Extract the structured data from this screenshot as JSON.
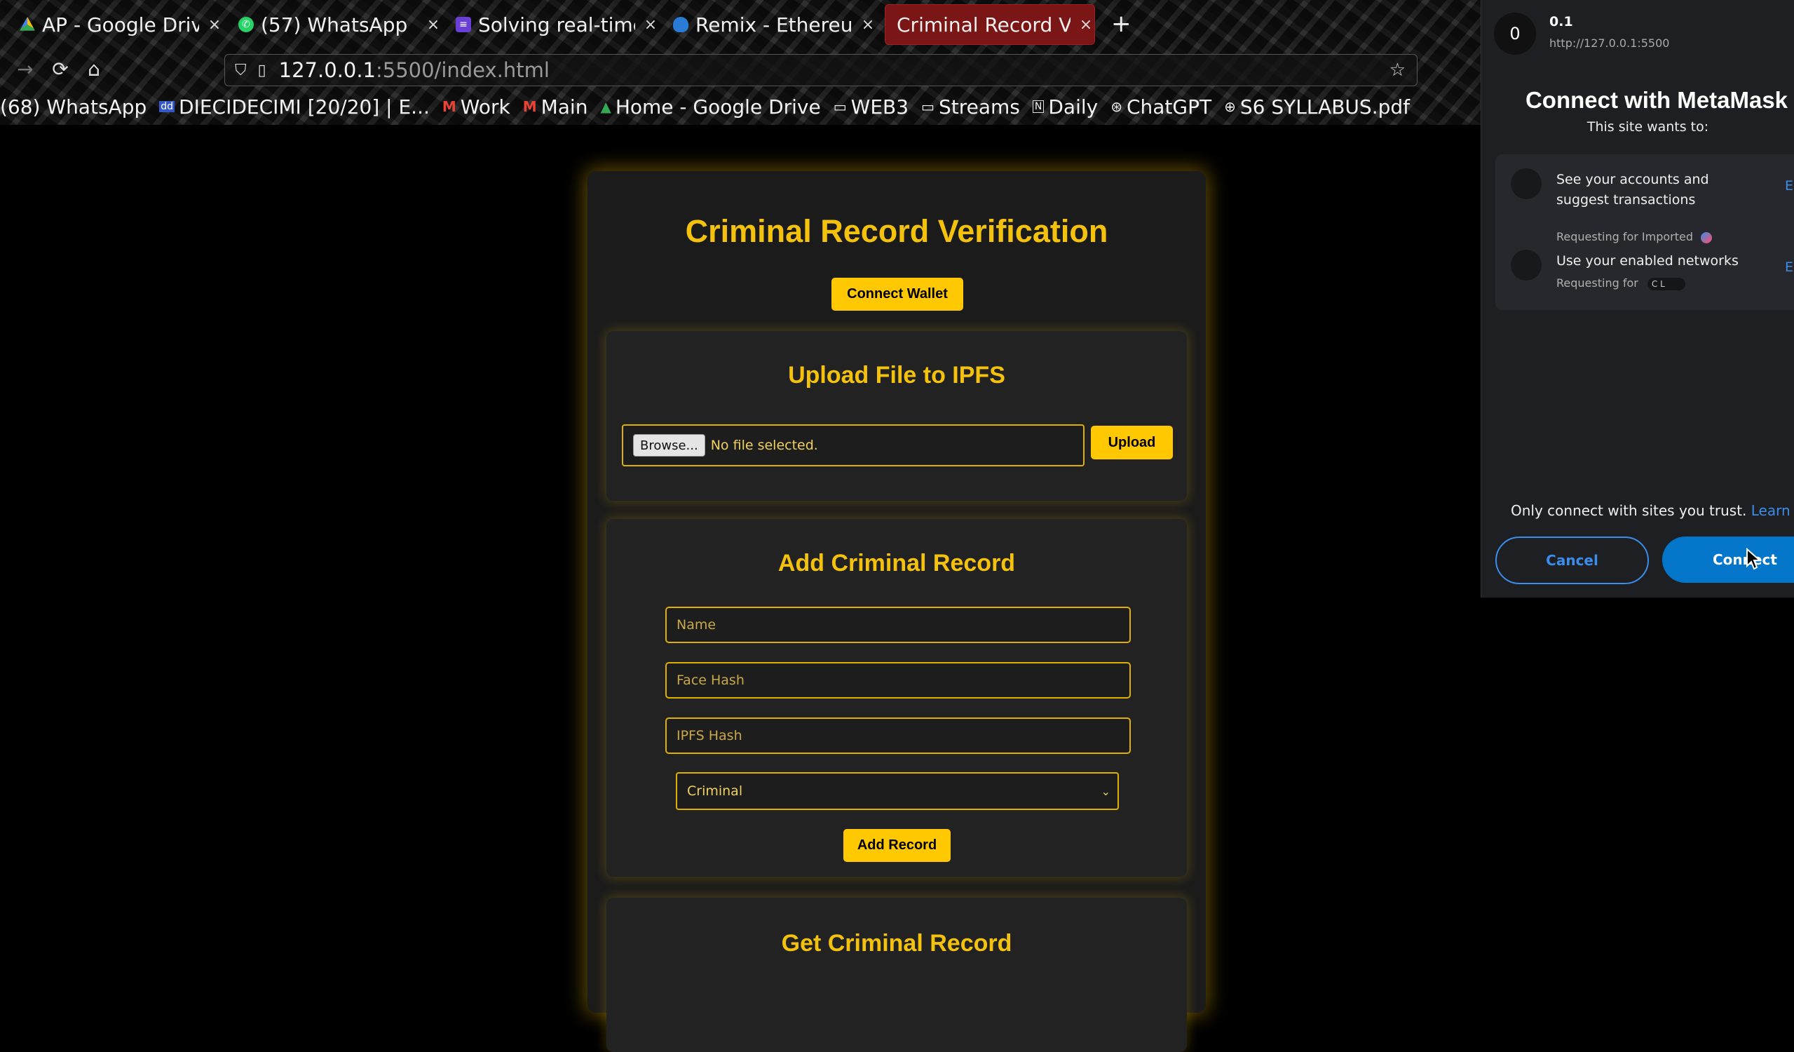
{
  "browser": {
    "tabs": [
      {
        "title": "AP - Google Drive",
        "icon": "google-drive-icon",
        "close": "×"
      },
      {
        "title": "(57) WhatsApp",
        "icon": "whatsapp-icon",
        "close": "×"
      },
      {
        "title": "Solving real-time u",
        "icon": "document-icon",
        "close": "×"
      },
      {
        "title": "Remix - Ethereum",
        "icon": "remix-icon",
        "close": "×"
      },
      {
        "title": "Criminal Record Verif",
        "icon": "page-icon",
        "close": "×"
      }
    ],
    "new_tab": "+",
    "url_host": "127.0.0.1",
    "url_path": ":5500/index.html",
    "bookmarks": [
      {
        "label": "(68) WhatsApp",
        "icon": ""
      },
      {
        "label": "DIECIDECIMI [20/20] | E...",
        "icon": "dd"
      },
      {
        "label": "Work",
        "icon": "M"
      },
      {
        "label": "Main",
        "icon": "M"
      },
      {
        "label": "Home - Google Drive",
        "icon": "▲"
      },
      {
        "label": "WEB3",
        "icon": "▭"
      },
      {
        "label": "Streams",
        "icon": "▭"
      },
      {
        "label": "Daily",
        "icon": "N"
      },
      {
        "label": "ChatGPT",
        "icon": "⊛"
      },
      {
        "label": "S6 SYLLABUS.pdf",
        "icon": "⊕"
      }
    ]
  },
  "app": {
    "title": "Criminal Record Verification",
    "connect_wallet": "Connect Wallet",
    "upload": {
      "title": "Upload File to IPFS",
      "browse": "Browse...",
      "file_status": "No file selected.",
      "button": "Upload"
    },
    "add_record": {
      "title": "Add Criminal Record",
      "name_placeholder": "Name",
      "face_hash_placeholder": "Face Hash",
      "ipfs_hash_placeholder": "IPFS Hash",
      "status_selected": "Criminal",
      "button": "Add Record"
    },
    "get_record": {
      "title": "Get Criminal Record"
    }
  },
  "metamask": {
    "avatar_letter": "0",
    "site_name": "0.1",
    "site_url": "http://127.0.0.1:5500",
    "title": "Connect with MetaMask",
    "subtitle": "This site wants to:",
    "permissions": [
      {
        "text": "See your accounts and suggest transactions",
        "sub": "Requesting for Imported",
        "edit": "Edit"
      },
      {
        "text": "Use your enabled networks",
        "sub": "Requesting for",
        "pill": "C L",
        "edit": "Edit"
      }
    ],
    "trust_text": "Only connect with sites you trust.",
    "learn_more": "Learn more",
    "cancel": "Cancel",
    "connect": "Connect",
    "accent": "#0376c9"
  },
  "colors": {
    "accent_yellow": "#ffc800",
    "title_yellow": "#f4c20d",
    "active_tab": "#7a1616"
  }
}
